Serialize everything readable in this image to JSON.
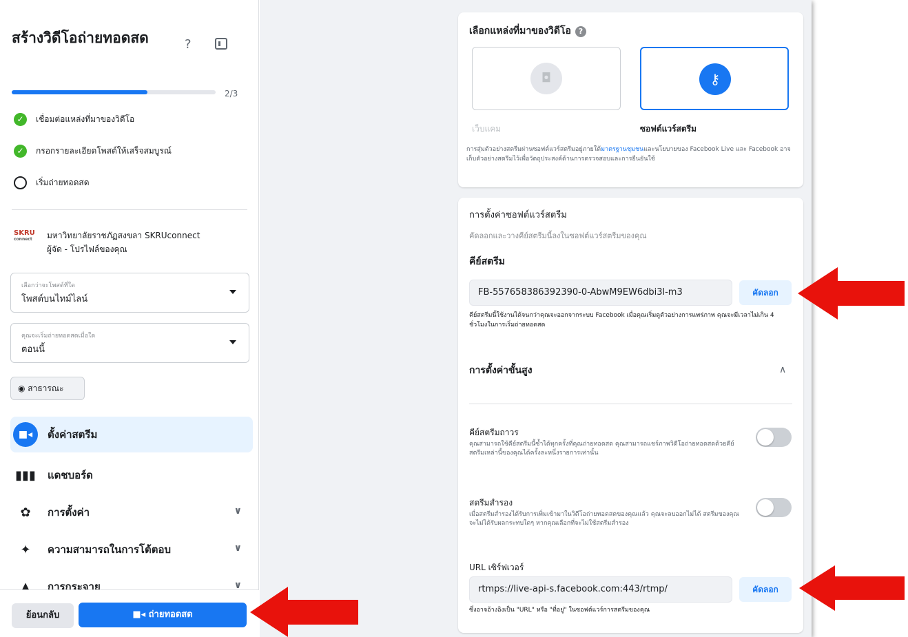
{
  "sidebar": {
    "title": "สร้างวิดีโอถ่ายทอดสด",
    "help_glyph": "?",
    "progress": {
      "fraction": 0.667,
      "text": "2/3"
    },
    "steps": [
      {
        "label": "เชื่อมต่อแหล่งที่มาของวิดีโอ",
        "done": true
      },
      {
        "label": "กรอกรายละเอียดโพสต์ให้เสร็จสมบูรณ์",
        "done": true
      },
      {
        "label": "เริ่มถ่ายทอดสด",
        "done": false
      }
    ],
    "page": {
      "logo_text": "SKRU",
      "logo_sub": "connect",
      "name": "มหาวิทยาลัยราชภัฏสงขลา SKRUconnect",
      "role": "ผู้จัด - โปรไฟล์ของคุณ"
    },
    "post_select": {
      "label": "เลือกว่าจะโพสต์ที่ใด",
      "value": "โพสต์บนไทม์ไลน์"
    },
    "time_select": {
      "label": "คุณจะเริ่มถ่ายทอดสดเมื่อใด",
      "value": "ตอนนี้"
    },
    "audience": "สาธารณะ",
    "nav": [
      {
        "label": "ตั้งค่าสตรีม",
        "icon": "video-camera-icon",
        "active": true
      },
      {
        "label": "แดชบอร์ด",
        "icon": "dashboard-icon",
        "active": false
      },
      {
        "label": "การตั้งค่า",
        "icon": "gear-icon",
        "active": false,
        "chevron": true
      },
      {
        "label": "ความสามารถในการโต้ตอบ",
        "icon": "sparkle-icon",
        "active": false,
        "chevron": true
      },
      {
        "label": "การกระจาย",
        "icon": "share-icon",
        "active": false,
        "chevron": true
      }
    ],
    "back_label": "ย้อนกลับ",
    "golive_label": "ถ่ายทอดสด"
  },
  "source_card": {
    "title": "เลือกแหล่งที่มาของวิดีโอ",
    "help_glyph": "?",
    "camera_label": "เว็บแคม",
    "stream_label": "ซอฟต์แวร์สตรีม",
    "description_pre": "การสุ่มตัวอย่างสตรีมผ่านซอฟต์แวร์สตรีมอยู่ภายใต้",
    "description_link": "มาตรฐานชุมชน",
    "description_post": "และนโยบายของ Facebook Live และ Facebook อาจเก็บตัวอย่างสตรีมไว้เพื่อวัตถุประสงค์ด้านการตรวจสอบและการยืนยันใช้"
  },
  "stream_card": {
    "title": "การตั้งค่าซอฟต์แวร์สตรีม",
    "subtitle": "คัดลอกและวางคีย์สตรีมนี้ลงในซอฟต์แวร์สตรีมของคุณ",
    "key_label": "คีย์สตรีม",
    "key_value": "FB-557658386392390-0-AbwM9EW6dbi3l-m3",
    "copy_label": "คัดลอก",
    "key_note": "คีย์สตรีมนี้ใช้งานได้จนกว่าคุณจะออกจากระบบ Facebook เมื่อคุณเริ่มดูตัวอย่างการแพร่ภาพ คุณจะมีเวลาไม่เกิน 4 ชั่วโมงในการเริ่มถ่ายทอดสด",
    "advanced_title": "การตั้งค่าขั้นสูง",
    "persistent_title": "คีย์สตรีมถาวร",
    "persistent_desc": "คุณสามารถใช้คีย์สตรีมนี้ซ้ำได้ทุกครั้งที่คุณถ่ายทอดสด คุณสามารถแชร์ภาพวิดีโอถ่ายทอดสดด้วยคีย์สตรีมเหล่านี้ของคุณได้ครั้งละหนึ่งรายการเท่านั้น",
    "backup_title": "สตรีมสำรอง",
    "backup_desc": "เมื่อสตรีมสำรองได้รับการเพิ่มเข้ามาในวิดีโอถ่ายทอดสดของคุณแล้ว คุณจะลบออกไม่ได้ สตรีมของคุณจะไม่ได้รับผลกระทบใดๆ หากคุณเลือกที่จะไม่ใช้สตรีมสำรอง",
    "url_label": "URL เซิร์ฟเวอร์",
    "url_value": "rtmps://live-api-s.facebook.com:443/rtmp/",
    "url_copy_label": "คัดลอก",
    "url_note": "ซึ่งอาจอ้างอิงเป็น \"URL\" หรือ \"ที่อยู่\" ในซอฟต์แวร์การสตรีมของคุณ"
  },
  "colors": {
    "accent": "#1877f2",
    "success": "#42b72a",
    "annotation": "#e8120c"
  }
}
